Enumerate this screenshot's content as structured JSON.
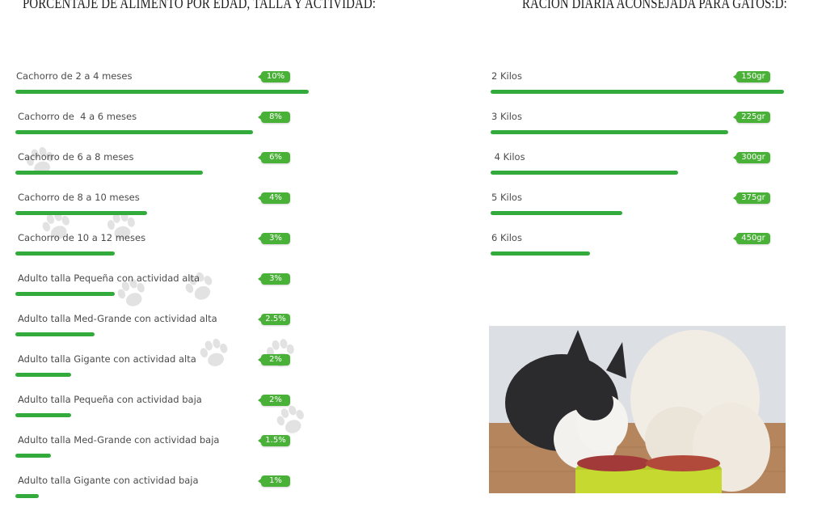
{
  "left_section": {
    "title": "porcentaje de alimento por edad, talla y actividad:",
    "rows": [
      {
        "label": "Cachorro de 2 a 4 meses",
        "badge": "10%",
        "fill": 1.0
      },
      {
        "label": "Cachorro de  4 a 6 meses",
        "badge": "8%",
        "fill": 0.81
      },
      {
        "label": "Cachorro de 6 a 8 meses",
        "badge": "6%",
        "fill": 0.64
      },
      {
        "label": "Cachorro de 8 a 10 meses",
        "badge": "4%",
        "fill": 0.45
      },
      {
        "label": "Cachorro de 10 a 12 meses",
        "badge": "3%",
        "fill": 0.34
      },
      {
        "label": "Adulto talla Pequeña con actividad alta",
        "badge": "3%",
        "fill": 0.34
      },
      {
        "label": "Adulto talla Med-Grande con actividad alta",
        "badge": "2.5%",
        "fill": 0.27
      },
      {
        "label": "Adulto talla Gigante con actividad alta",
        "badge": "2%",
        "fill": 0.19
      },
      {
        "label": "Adulto talla Pequeña con actividad baja",
        "badge": "2%",
        "fill": 0.19
      },
      {
        "label": "Adulto talla Med-Grande con actividad baja",
        "badge": "1.5%",
        "fill": 0.12
      },
      {
        "label": "Adulto talla Gigante con actividad baja",
        "badge": "1%",
        "fill": 0.08
      }
    ]
  },
  "right_section": {
    "title": "ración diaria aconsejada para gatos:d:",
    "rows": [
      {
        "label": "2 Kilos",
        "badge": "150gr",
        "fill": 1.0
      },
      {
        "label": "3 Kilos",
        "badge": "225gr",
        "fill": 0.81
      },
      {
        "label": " 4 Kilos",
        "badge": "300gr",
        "fill": 0.64
      },
      {
        "label": "5 Kilos",
        "badge": "375gr",
        "fill": 0.45
      },
      {
        "label": "6 Kilos",
        "badge": "450gr",
        "fill": 0.34
      }
    ]
  },
  "colors": {
    "bar": "#33ab3c",
    "badge": "#4ab138",
    "paw": "#d9d9d9"
  },
  "photo": {
    "icon": "cat-and-dog-eating-photo"
  }
}
